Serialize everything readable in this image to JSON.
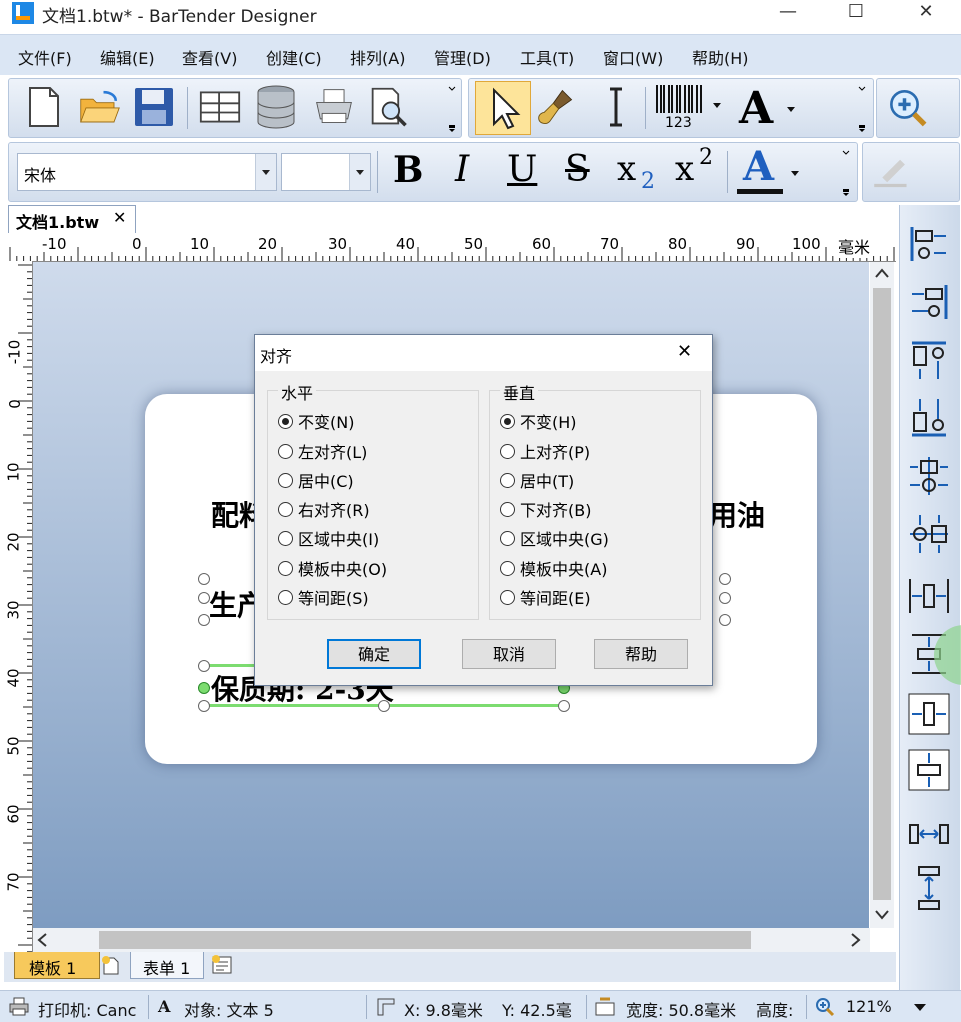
{
  "window": {
    "title": "文档1.btw* - BarTender Designer",
    "controls": {
      "minimize": "—",
      "maximize": "☐",
      "close": "✕"
    }
  },
  "menu": [
    "文件(F)",
    "编辑(E)",
    "查看(V)",
    "创建(C)",
    "排列(A)",
    "管理(D)",
    "工具(T)",
    "窗口(W)",
    "帮助(H)"
  ],
  "toolbar": {
    "barcode_caption": "123",
    "text_tool": "A"
  },
  "format_toolbar": {
    "font_name": "宋体",
    "font_size": "",
    "bold": "B",
    "italic": "I",
    "underline": "U",
    "strike": "S",
    "subscript": "x",
    "subscript_mark": "2",
    "superscript": "x",
    "superscript_mark": "2",
    "font_color": "A"
  },
  "document_tab": {
    "label": "文档1.btw",
    "close": "✕"
  },
  "ruler": {
    "h_labels": [
      "-10",
      "0",
      "10",
      "20",
      "30",
      "40",
      "50",
      "60",
      "70",
      "80",
      "90",
      "100"
    ],
    "h_unit": "毫米",
    "v_labels": [
      "-10",
      "0",
      "10",
      "20",
      "30",
      "40",
      "50",
      "60",
      "70"
    ]
  },
  "label": {
    "line1_left": "配料",
    "line1_right": "用油",
    "line2": "生产",
    "line3": "保质期: 2-3天"
  },
  "sheet_tabs": [
    {
      "label": "模板 1"
    },
    {
      "label": "表单 1"
    }
  ],
  "status": {
    "printer": "打印机: Canc",
    "object_icon": "A",
    "object": "对象: 文本 5",
    "x": "X: 9.8毫米",
    "y": "Y: 42.5毫",
    "width": "宽度: 50.8毫米",
    "height": "高度:",
    "zoom": "121%"
  },
  "dialog": {
    "title": "对齐",
    "close": "✕",
    "horizontal": {
      "title": "水平",
      "options": [
        "不变(N)",
        "左对齐(L)",
        "居中(C)",
        "右对齐(R)",
        "区域中央(I)",
        "模板中央(O)",
        "等间距(S)"
      ],
      "selected": "不变(N)"
    },
    "vertical": {
      "title": "垂直",
      "options": [
        "不变(H)",
        "上对齐(P)",
        "居中(T)",
        "下对齐(B)",
        "区域中央(G)",
        "模板中央(A)",
        "等间距(E)"
      ],
      "selected": "不变(H)"
    },
    "buttons": {
      "ok": "确定",
      "cancel": "取消",
      "help": "帮助"
    }
  },
  "colors": {
    "chrome": "#dbe6f4",
    "canvas_top": "#cfdbec",
    "canvas_bottom": "#7e9cc1",
    "selection_green": "#7cdc70",
    "default_button_border": "#0078d7"
  }
}
